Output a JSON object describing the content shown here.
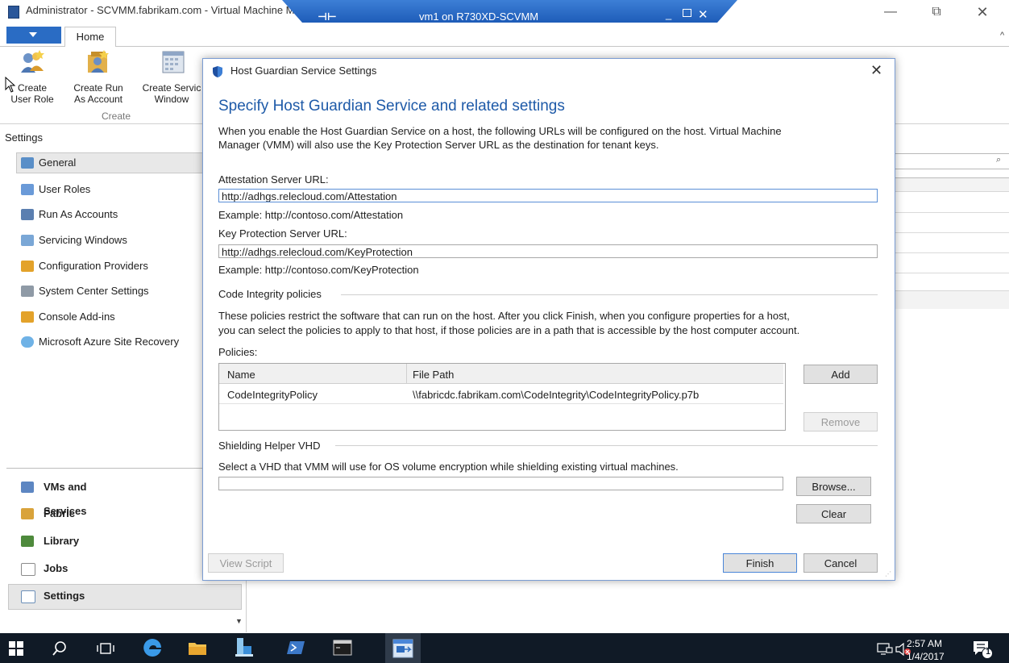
{
  "window": {
    "title": "Administrator - SCVMM.fabrikam.com - Virtual Machine Manager",
    "minimize_glyph": "—",
    "maximize_glyph": "⧉",
    "close_glyph": "✕"
  },
  "remote_desktop_bar": {
    "title": "vm1 on R730XD-SCVMM",
    "pin_glyph": "⊣⊢",
    "minimize_glyph": "_",
    "close_glyph": "✕"
  },
  "ribbon": {
    "tabs": [
      "Home"
    ],
    "collapse_glyph": "^",
    "buttons": [
      {
        "line1": "Create",
        "line2": "User Role",
        "icon": "user-role-icon"
      },
      {
        "line1": "Create Run",
        "line2": "As Account",
        "icon": "run-as-account-icon"
      },
      {
        "line1": "Create Servic",
        "line2": "Window",
        "icon": "servicing-window-icon"
      }
    ],
    "group_label": "Create"
  },
  "left_nav": {
    "heading": "Settings",
    "items": [
      {
        "label": "General",
        "icon": "general-icon",
        "color": "#5a8fc8"
      },
      {
        "label": "User Roles",
        "icon": "user-roles-icon",
        "color": "#6a9ad8"
      },
      {
        "label": "Run As Accounts",
        "icon": "run-as-icon",
        "color": "#5b7fb0"
      },
      {
        "label": "Servicing Windows",
        "icon": "servicing-windows-icon",
        "color": "#7aa7d6"
      },
      {
        "label": "Configuration Providers",
        "icon": "configuration-providers-icon",
        "color": "#e3a22a"
      },
      {
        "label": "System Center Settings",
        "icon": "system-center-settings-icon",
        "color": "#8f9aa6"
      },
      {
        "label": "Console Add-ins",
        "icon": "console-addins-icon",
        "color": "#e3a22a"
      },
      {
        "label": "Microsoft Azure Site Recovery",
        "icon": "azure-site-recovery-icon",
        "color": "#6fb2e6"
      }
    ],
    "workspaces": [
      {
        "label": "VMs and Services",
        "icon": "vms-services-icon",
        "color": "#5d86c2"
      },
      {
        "label": "Fabric",
        "icon": "fabric-icon",
        "color": "#d9a33b"
      },
      {
        "label": "Library",
        "icon": "library-icon",
        "color": "#4e8a3c"
      },
      {
        "label": "Jobs",
        "icon": "jobs-icon",
        "color": "#8b8b8b"
      },
      {
        "label": "Settings",
        "icon": "settings-icon",
        "color": "#6c8fb8"
      }
    ]
  },
  "dialog": {
    "title": "Host Guardian Service Settings",
    "close_glyph": "✕",
    "heading": "Specify Host Guardian Service and related settings",
    "intro_line1": "When you enable the Host Guardian Service on a host, the following URLs will be configured on the host. Virtual Machine",
    "intro_line2": "Manager (VMM) will also use the Key Protection Server URL as the destination for tenant keys.",
    "attestation": {
      "label": "Attestation Server URL:",
      "value": "http://adhgs.relecloud.com/Attestation",
      "example": "Example: http://contoso.com/Attestation"
    },
    "key_protection": {
      "label": "Key Protection Server URL:",
      "value": "http://adhgs.relecloud.com/KeyProtection",
      "example": "Example: http://contoso.com/KeyProtection"
    },
    "code_integrity": {
      "group_label": "Code Integrity policies",
      "desc_line1": "These policies restrict the software that can run on the host. After you click Finish, when you configure properties for a host,",
      "desc_line2": "you can select the policies to apply to that host, if those policies are in a path that is accessible by the host computer account.",
      "policies_label": "Policies:",
      "columns": [
        "Name",
        "File Path"
      ],
      "rows": [
        {
          "name": "CodeIntegrityPolicy",
          "path": "\\\\fabricdc.fabrikam.com\\CodeIntegrity\\CodeIntegrityPolicy.p7b"
        }
      ],
      "add_label": "Add",
      "remove_label": "Remove"
    },
    "shielding": {
      "group_label": "Shielding Helper VHD",
      "desc": "Select a VHD that VMM will use for OS volume encryption while shielding existing virtual machines.",
      "value": "",
      "browse_label": "Browse...",
      "clear_label": "Clear"
    },
    "footer": {
      "view_script_label": "View Script",
      "finish_label": "Finish",
      "cancel_label": "Cancel"
    }
  },
  "taskbar": {
    "time": "2:57 AM",
    "date": "1/4/2017",
    "notification_count": "1",
    "accent": "#101a26"
  }
}
